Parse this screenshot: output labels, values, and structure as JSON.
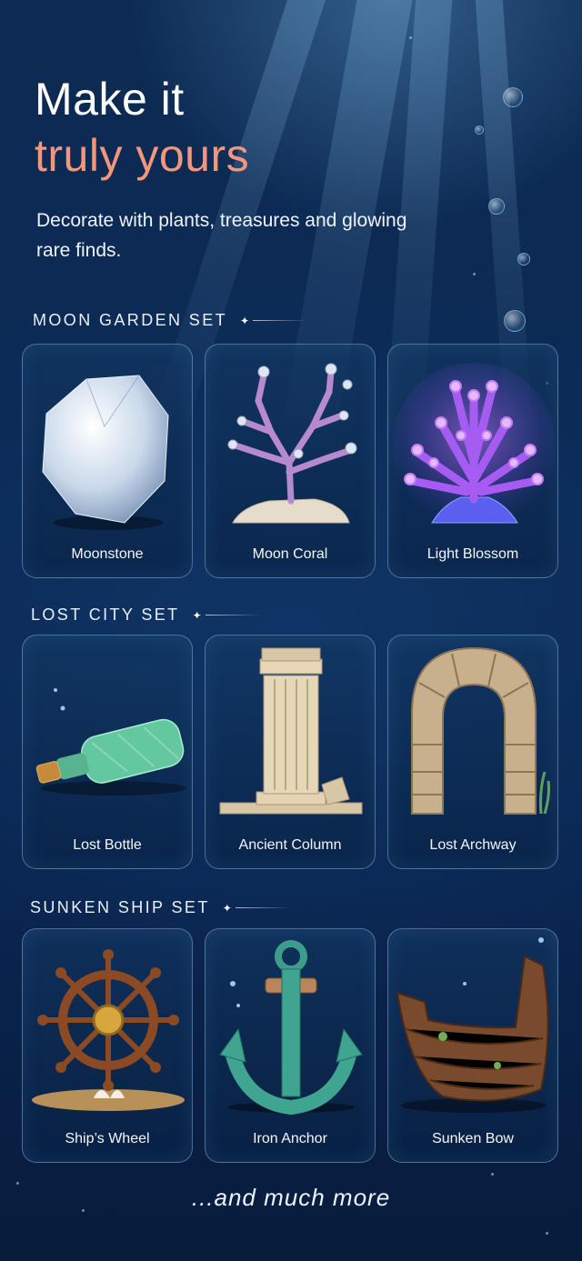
{
  "hero": {
    "title_line1": "Make it",
    "title_line2": "truly yours",
    "subtitle": "Decorate with plants, treasures and glowing rare finds."
  },
  "sections": [
    {
      "label": "MOON GARDEN SET",
      "items": [
        {
          "name": "Moonstone",
          "icon": "moonstone-icon"
        },
        {
          "name": "Moon Coral",
          "icon": "moon-coral-icon"
        },
        {
          "name": "Light Blossom",
          "icon": "light-blossom-icon"
        }
      ]
    },
    {
      "label": "LOST CITY SET",
      "items": [
        {
          "name": "Lost Bottle",
          "icon": "bottle-icon"
        },
        {
          "name": "Ancient Column",
          "icon": "column-icon"
        },
        {
          "name": "Lost Archway",
          "icon": "archway-icon"
        }
      ]
    },
    {
      "label": "SUNKEN SHIP SET",
      "items": [
        {
          "name": "Ship’s Wheel",
          "icon": "ships-wheel-icon"
        },
        {
          "name": "Iron Anchor",
          "icon": "anchor-icon"
        },
        {
          "name": "Sunken Bow",
          "icon": "sunken-bow-icon"
        }
      ]
    }
  ],
  "footer": "...and much more",
  "colors": {
    "background": "#0b2244",
    "accent": "#f4957c",
    "card_border": "#a0c8eb"
  }
}
